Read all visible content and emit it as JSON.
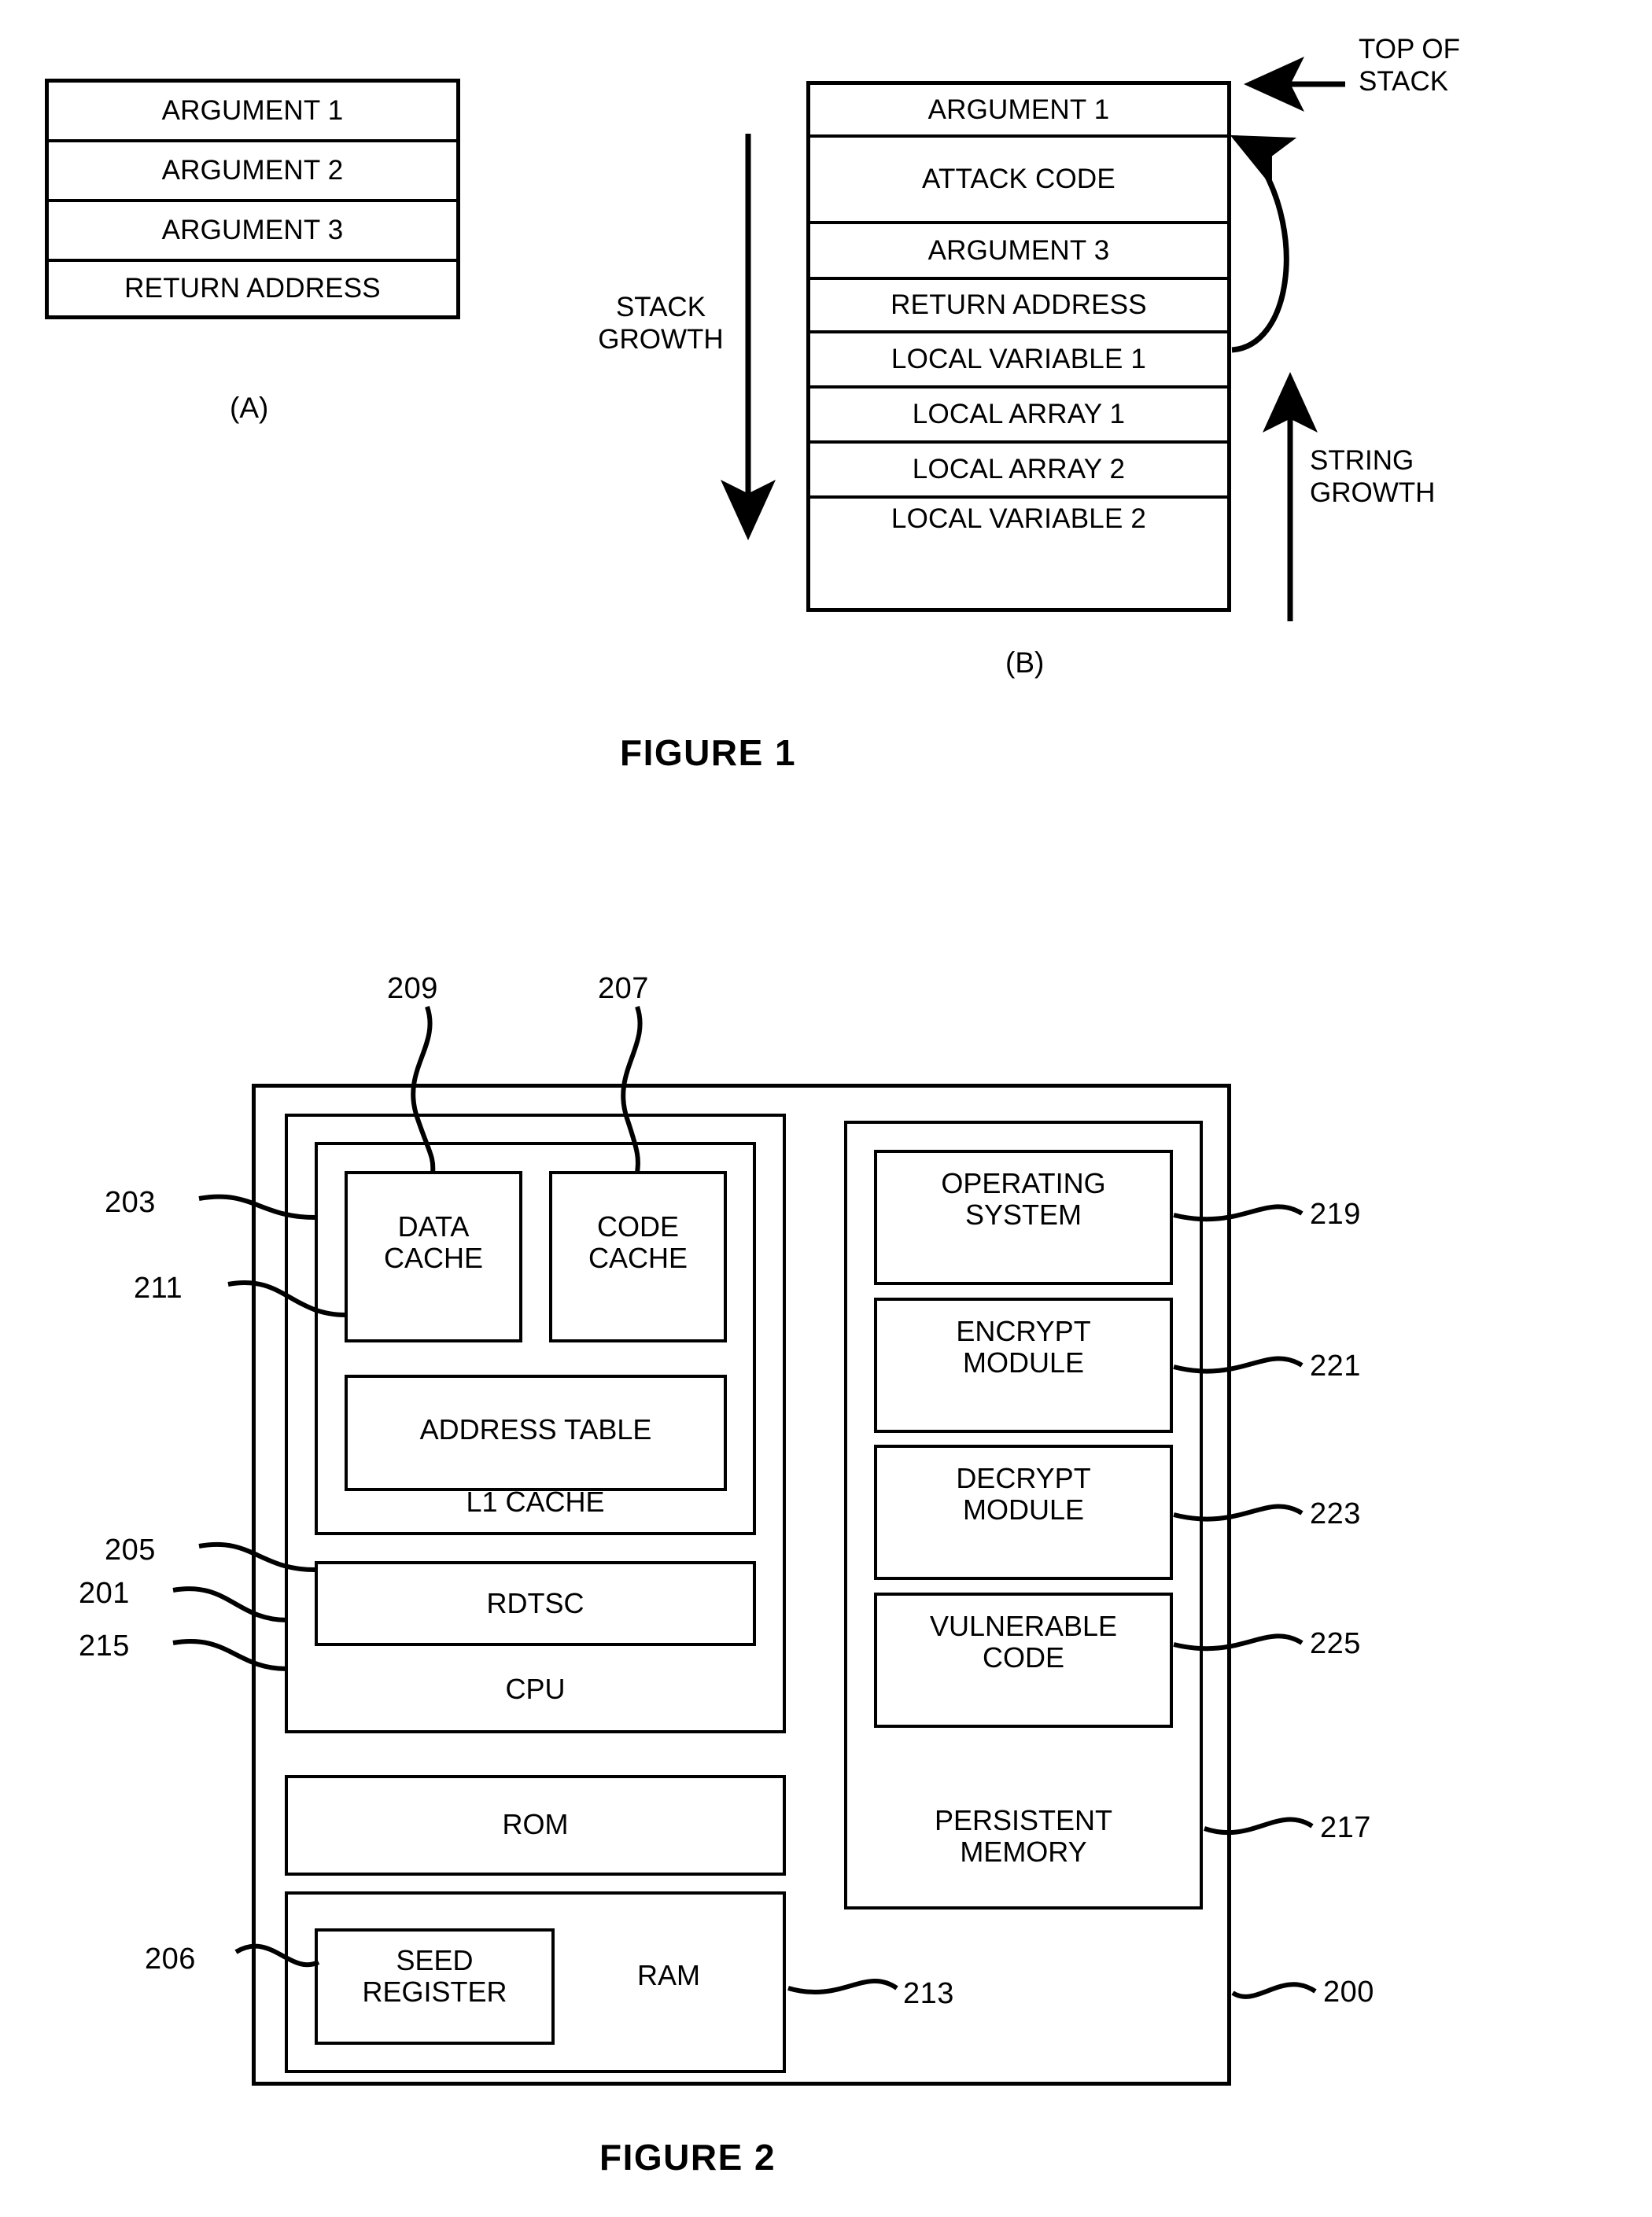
{
  "figure1": {
    "caption": "FIGURE 1",
    "stack_a": {
      "label": "(A)",
      "rows": [
        "ARGUMENT 1",
        "ARGUMENT 2",
        "ARGUMENT 3",
        "RETURN ADDRESS"
      ]
    },
    "stack_b": {
      "label": "(B)",
      "rows": [
        "ARGUMENT 1",
        "ATTACK CODE",
        "ARGUMENT 3",
        "RETURN ADDRESS",
        "LOCAL VARIABLE 1",
        "LOCAL ARRAY 1",
        "LOCAL ARRAY 2",
        "LOCAL VARIABLE 2"
      ]
    },
    "annotations": {
      "top_of_stack": "TOP OF\nSTACK",
      "stack_growth": "STACK\nGROWTH",
      "string_growth": "STRING\nGROWTH"
    }
  },
  "figure2": {
    "caption": "FIGURE 2",
    "blocks": {
      "data_cache": "DATA\nCACHE",
      "code_cache": "CODE\nCACHE",
      "address_table": "ADDRESS TABLE",
      "l1_cache": "L1 CACHE",
      "rdtsc": "RDTSC",
      "cpu": "CPU",
      "rom": "ROM",
      "seed_register": "SEED\nREGISTER",
      "ram": "RAM",
      "operating_system": "OPERATING\nSYSTEM",
      "encrypt_module": "ENCRYPT\nMODULE",
      "decrypt_module": "DECRYPT\nMODULE",
      "vulnerable_code": "VULNERABLE\nCODE",
      "persistent_memory": "PERSISTENT\nMEMORY"
    },
    "refs": {
      "r209": "209",
      "r207": "207",
      "r203": "203",
      "r211": "211",
      "r205": "205",
      "r201": "201",
      "r215": "215",
      "r206": "206",
      "r213": "213",
      "r219": "219",
      "r221": "221",
      "r223": "223",
      "r225": "225",
      "r217": "217",
      "r200": "200"
    }
  }
}
